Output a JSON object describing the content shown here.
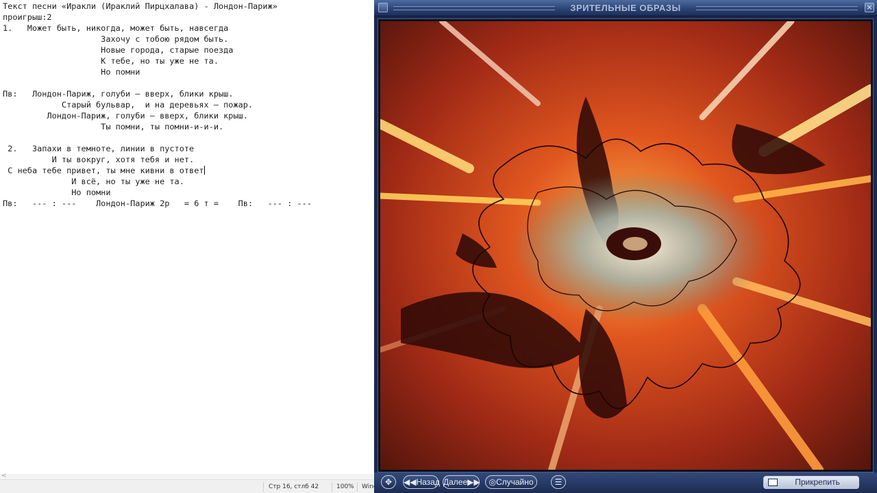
{
  "editor": {
    "lines": [
      "Текст песни «Иракли (Ираклий Пирцхалава) - Лондон-Париж»",
      "проигрыш:2",
      "1.   Может быть, никогда, может быть, навсегда",
      "                    Захочу с тобою рядом быть.",
      "                    Новые города, старые поезда",
      "                    К тебе, но ты уже не та.",
      "                    Но помни",
      "",
      "Пв:   Лондон-Париж, голуби – вверх, блики крыш.",
      "            Старый бульвар,  и на деревьях – пожар.",
      "         Лондон-Париж, голуби – вверх, блики крыш.",
      "                    Ты помни, ты помни-и-и-и.",
      "",
      " 2.   Запахи в темноте, линии в пустоте",
      "          И ты вокруг, хотя тебя и нет.",
      " С неба тебе привет, ты мне кивни в ответ",
      "              И всё, но ты уже не та.",
      "              Но помни",
      "Пв:   --- : ---    Лондон-Париж 2р   = 6 т =    Пв:   --- : ---"
    ],
    "caret_line": 15
  },
  "statusbar": {
    "position": "Стр 16, стлб 42",
    "zoom": "100%",
    "line_ending": "Wind"
  },
  "player": {
    "title": "ЗРИТЕЛЬНЫЕ ОБРАЗЫ",
    "buttons": {
      "back": "Назад",
      "next": "Далее",
      "random": "Случайно",
      "attach": "Прикрепить"
    },
    "icons": {
      "window": "player-window-icon",
      "close": "close-icon",
      "move": "move-icon",
      "settings": "settings-icon"
    }
  },
  "colors": {
    "viz_dark": "#3b0d08",
    "viz_red": "#b8321a",
    "viz_orange": "#ff8a1e",
    "viz_yellow": "#ffe27a",
    "viz_gray": "#8c9a96",
    "player_frame": "#1b2a52"
  }
}
